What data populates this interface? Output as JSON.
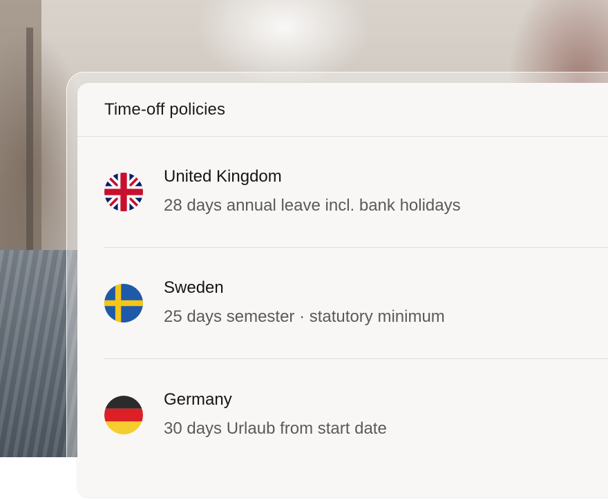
{
  "card": {
    "title": "Time-off policies"
  },
  "policies": [
    {
      "country": "United Kingdom",
      "description": "28 days annual leave incl. bank holidays",
      "flag_icon": "uk-flag-icon"
    },
    {
      "country": "Sweden",
      "description": "25 days semester · statutory minimum",
      "flag_icon": "sweden-flag-icon"
    },
    {
      "country": "Germany",
      "description": "30 days Urlaub from start date",
      "flag_icon": "germany-flag-icon"
    }
  ],
  "colors": {
    "card_background": "#f8f7f5",
    "divider": "#dedcd9",
    "primary_text": "#151515",
    "secondary_text": "#5b5a58"
  }
}
